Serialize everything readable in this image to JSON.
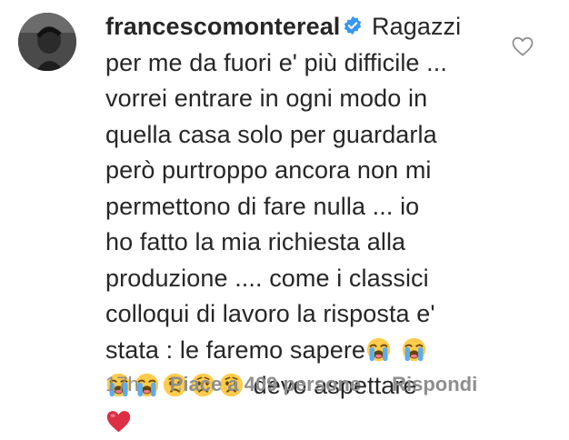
{
  "comment": {
    "username": "francescomontereal",
    "verified": true,
    "text_part1": "Ragazzi\nper me da fuori e' più difficile ...\nvorrei entrare in ogni modo in\nquella casa solo per guardarla\nperò purtroppo ancora non mi\npermettono di fare nulla ... io\nho fatto la mia richiesta alla\nproduzione .... come i classici\ncolloqui di lavoro la risposta e'\nstata : le faremo sapere",
    "text_part2": " devo aspettare",
    "emojis_line1": [
      "loudly-crying-face",
      "loudly-crying-face"
    ],
    "emojis_line2": [
      "loudly-crying-face",
      "loudly-crying-face",
      "crying-face",
      "crying-face",
      "crying-face"
    ],
    "emoji_end": "red-heart"
  },
  "meta": {
    "time": "17h",
    "likes": "Piace a 409 persone",
    "reply": "Rispondi"
  },
  "colors": {
    "text": "#262626",
    "secondary": "#8e8e8e",
    "verified": "#3897f0",
    "heart": "#d0021b"
  }
}
